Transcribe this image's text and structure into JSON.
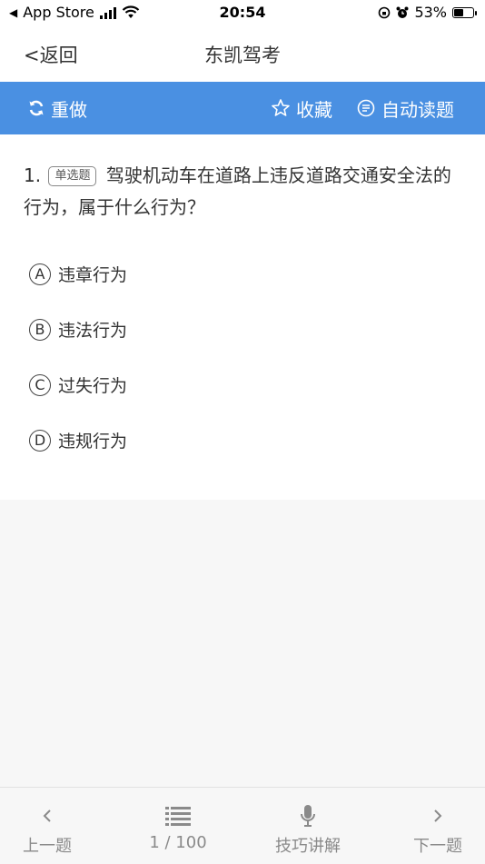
{
  "status": {
    "carrier": "App Store",
    "time": "20:54",
    "battery": "53%",
    "battery_level": 0.53
  },
  "nav": {
    "back_label": "<返回",
    "title": "东凯驾考"
  },
  "toolbar": {
    "redo_label": "重做",
    "favorite_label": "收藏",
    "autoread_label": "自动读题"
  },
  "question": {
    "number": "1.",
    "type_badge": "单选题",
    "text": "驾驶机动车在道路上违反道路交通安全法的行为，属于什么行为？",
    "options": [
      {
        "letter": "A",
        "text": "违章行为"
      },
      {
        "letter": "B",
        "text": "违法行为"
      },
      {
        "letter": "C",
        "text": "过失行为"
      },
      {
        "letter": "D",
        "text": "违规行为"
      }
    ]
  },
  "bottom": {
    "prev_label": "上一题",
    "progress": "1 / 100",
    "tips_label": "技巧讲解",
    "next_label": "下一题"
  },
  "colors": {
    "accent": "#4a90e2",
    "icon_gray": "#8a8a8a"
  }
}
